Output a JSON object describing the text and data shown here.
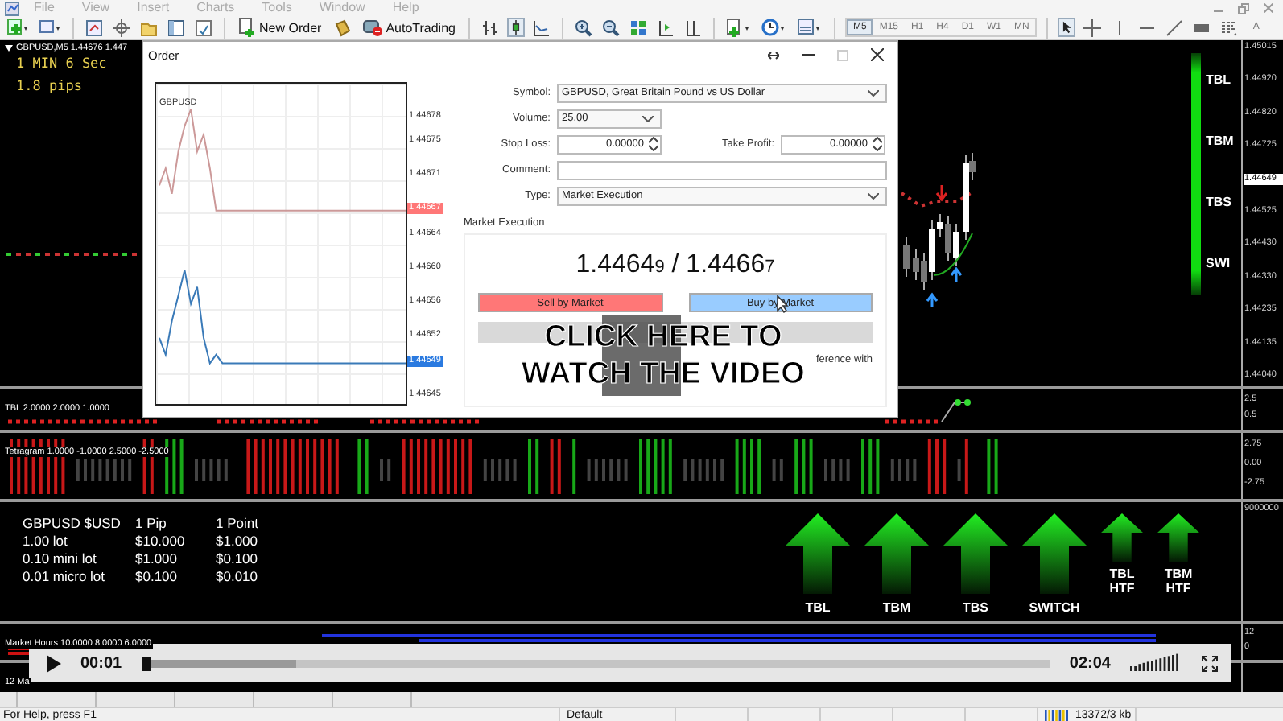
{
  "menu": [
    "File",
    "View",
    "Insert",
    "Charts",
    "Tools",
    "Window",
    "Help"
  ],
  "toolbar": {
    "new_order": "New Order",
    "auto_trading": "AutoTrading",
    "text_tool": "A",
    "timeframes": [
      {
        "label": "M5",
        "selected": true
      },
      {
        "label": "M15",
        "selected": false
      },
      {
        "label": "H1",
        "selected": false
      },
      {
        "label": "H4",
        "selected": false
      },
      {
        "label": "D1",
        "selected": false
      },
      {
        "label": "W1",
        "selected": false
      },
      {
        "label": "MN",
        "selected": false
      }
    ]
  },
  "chart": {
    "title": "GBPUSD,M5  1.44676 1.447",
    "info": [
      "1 MIN 6 Sec",
      "1.8 pips"
    ],
    "signals": [
      "TBL",
      "TBM",
      "TBS",
      "SWI"
    ],
    "axis": [
      {
        "label": "1.45015",
        "current": false
      },
      {
        "label": "1.44920",
        "current": false
      },
      {
        "label": "1.44820",
        "current": false
      },
      {
        "label": "1.44725",
        "current": false
      },
      {
        "label": "1.44649",
        "current": true
      },
      {
        "label": "1.44525",
        "current": false
      },
      {
        "label": "1.44430",
        "current": false
      },
      {
        "label": "1.44330",
        "current": false
      },
      {
        "label": "1.44235",
        "current": false
      },
      {
        "label": "1.44135",
        "current": false
      },
      {
        "label": "1.44040",
        "current": false
      }
    ]
  },
  "order": {
    "title": "Order",
    "tick_chart": {
      "chart_data": {
        "type": "line",
        "title": "GBPUSD",
        "ylim": [
          1.44644,
          1.44682
        ],
        "yticks": [
          {
            "value": 1.44678,
            "label": "1.44678"
          },
          {
            "value": 1.44675,
            "label": "1.44675"
          },
          {
            "value": 1.44671,
            "label": "1.44671"
          },
          {
            "value": 1.44667,
            "label": "1.44667"
          },
          {
            "value": 1.44664,
            "label": "1.44664"
          },
          {
            "value": 1.4466,
            "label": "1.44660"
          },
          {
            "value": 1.44656,
            "label": "1.44656"
          },
          {
            "value": 1.44652,
            "label": "1.44652"
          },
          {
            "value": 1.44649,
            "label": "1.44649"
          },
          {
            "value": 1.44645,
            "label": "1.44645"
          }
        ],
        "series": [
          {
            "color": "#cc9999",
            "values": [
              1.4467,
              1.44672,
              1.44669,
              1.44674,
              1.44677,
              1.44679,
              1.44674,
              1.44676,
              1.44672,
              1.44667,
              1.44667,
              1.44667,
              1.44667,
              1.44667,
              1.44667,
              1.44667,
              1.44667,
              1.44667,
              1.44667,
              1.44667,
              1.44667,
              1.44667,
              1.44667,
              1.44667,
              1.44667,
              1.44667,
              1.44667,
              1.44667,
              1.44667,
              1.44667,
              1.44667,
              1.44667,
              1.44667,
              1.44667,
              1.44667,
              1.44667,
              1.44667,
              1.44667,
              1.44667,
              1.44667
            ]
          },
          {
            "color": "#3a7ab8",
            "values": [
              1.44652,
              1.4465,
              1.44654,
              1.44657,
              1.4466,
              1.44656,
              1.44658,
              1.44652,
              1.44649,
              1.4465,
              1.44649,
              1.44649,
              1.44649,
              1.44649,
              1.44649,
              1.44649,
              1.44649,
              1.44649,
              1.44649,
              1.44649,
              1.44649,
              1.44649,
              1.44649,
              1.44649,
              1.44649,
              1.44649,
              1.44649,
              1.44649,
              1.44649,
              1.44649,
              1.44649,
              1.44649,
              1.44649,
              1.44649,
              1.44649,
              1.44649,
              1.44649,
              1.44649,
              1.44649,
              1.44649
            ]
          }
        ]
      }
    },
    "symbol": {
      "label": "Symbol:",
      "value": "GBPUSD, Great Britain Pound vs US Dollar"
    },
    "volume": {
      "label": "Volume:",
      "value": "25.00"
    },
    "stop_loss": {
      "label": "Stop Loss:",
      "value": "0.00000"
    },
    "take_profit": {
      "label": "Take Profit:",
      "value": "0.00000"
    },
    "comment": {
      "label": "Comment:"
    },
    "type": {
      "label": "Type:",
      "value": "Market Execution"
    },
    "group": "Market Execution",
    "bid": "1.4464",
    "bid_last": "9",
    "separator": "/",
    "ask": "1.4466",
    "ask_last": "7",
    "sell_button": "Sell by Market",
    "buy_button": "Buy by Market",
    "note_fragment": "ference with"
  },
  "overlay": {
    "lines": [
      "CLICK HERE TO",
      "WATCH THE VIDEO"
    ]
  },
  "indicators": [
    {
      "title": "TBL 2.0000 2.0000 1.0000",
      "axis": [
        "2.5",
        "0.5"
      ]
    },
    {
      "title": "Tetragram 1.0000 -1.0000 2.5000 -2.5000",
      "axis": [
        "2.75",
        "0.00",
        "-2.75"
      ]
    }
  ],
  "trade_panel": {
    "axis": "9000000",
    "table": [
      [
        "GBPUSD $USD",
        "1 Pip",
        "1 Point"
      ],
      [
        "1.00 lot",
        "$10.000",
        "$1.000"
      ],
      [
        "0.10 mini lot",
        "$1.000",
        "$0.100"
      ],
      [
        "0.01 micro lot",
        "$0.100",
        "$0.010"
      ]
    ],
    "arrows": [
      {
        "label": "TBL",
        "kind": "large"
      },
      {
        "label": "TBM",
        "kind": "large"
      },
      {
        "label": "TBS",
        "kind": "large"
      },
      {
        "label": "SWITCH",
        "kind": "large"
      },
      {
        "label": "TBL HTF",
        "kind": "small"
      },
      {
        "label": "TBM HTF",
        "kind": "small"
      }
    ]
  },
  "market_hours": {
    "title": "Market Hours 10.0000 8.0000 6.0000",
    "axis": [
      "12",
      "0"
    ]
  },
  "lower_pane": {
    "title": "12 Ma"
  },
  "player": {
    "elapsed": "00:01",
    "duration": "02:04",
    "progress": {
      "level": 0.012
    },
    "buffer": {
      "level": 0.17
    }
  },
  "status_bar": {
    "help": "For Help, press F1",
    "profile": "Default",
    "traffic": "13372/3 kb"
  }
}
